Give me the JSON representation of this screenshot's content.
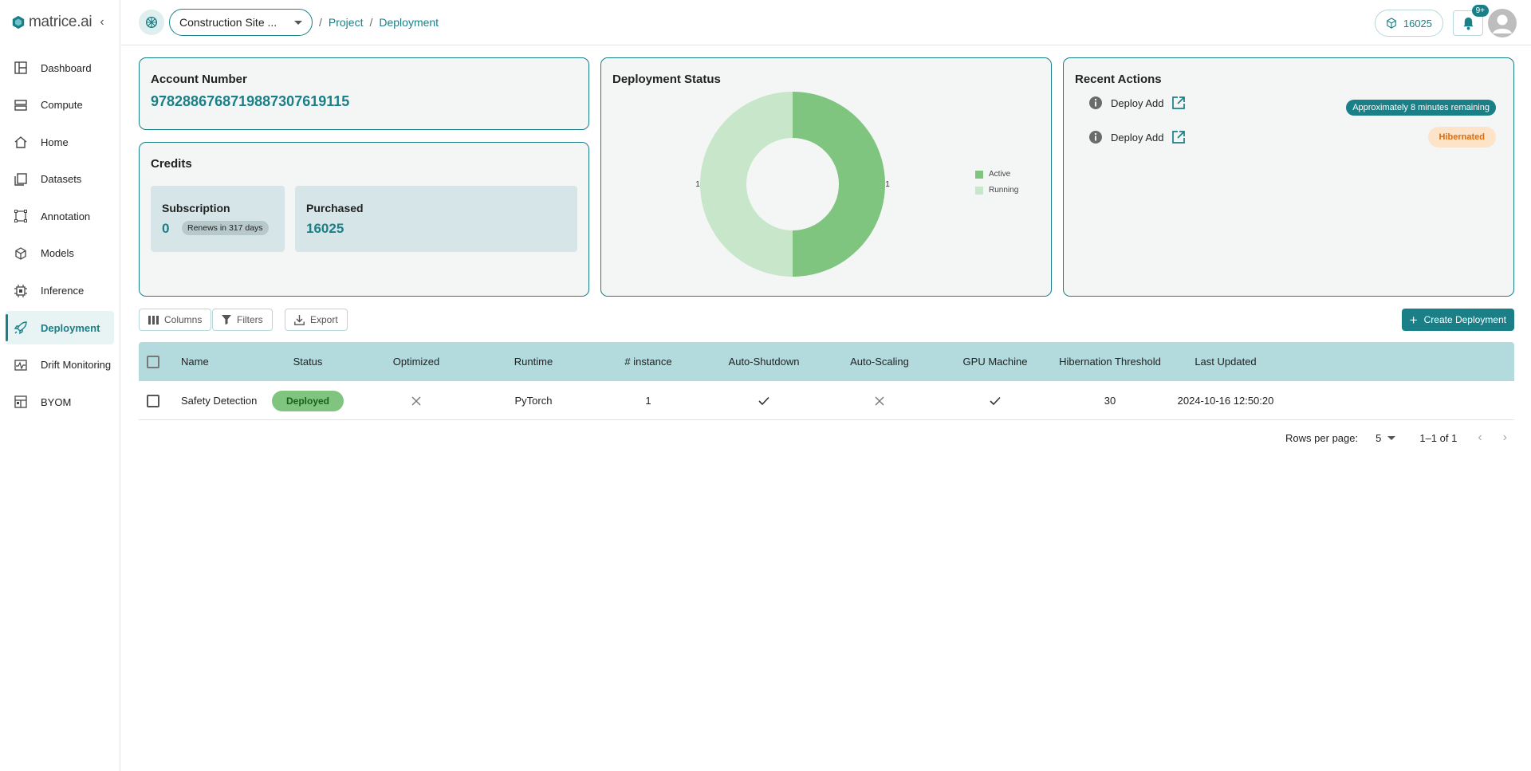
{
  "brand": {
    "name": "matrice.ai"
  },
  "sidebar": {
    "items": [
      {
        "label": "Dashboard",
        "icon": "dashboard-icon"
      },
      {
        "label": "Compute",
        "icon": "compute-icon"
      },
      {
        "label": "Home",
        "icon": "home-icon"
      },
      {
        "label": "Datasets",
        "icon": "datasets-icon"
      },
      {
        "label": "Annotation",
        "icon": "annotation-icon"
      },
      {
        "label": "Models",
        "icon": "models-icon"
      },
      {
        "label": "Inference",
        "icon": "inference-icon"
      },
      {
        "label": "Deployment",
        "icon": "rocket-icon",
        "active": true
      },
      {
        "label": "Drift Monitoring",
        "icon": "drift-icon"
      },
      {
        "label": "BYOM",
        "icon": "byom-icon"
      }
    ]
  },
  "header": {
    "project_name": "Construction Site ...",
    "breadcrumb": [
      "Project",
      "Deployment"
    ],
    "credits": "16025",
    "notifications_badge": "9+"
  },
  "account": {
    "title": "Account Number",
    "number": "97828867687198873076191​15"
  },
  "credits": {
    "title": "Credits",
    "subscription_label": "Subscription",
    "subscription_value": "0",
    "renews_text": "Renews in 317 days",
    "purchased_label": "Purchased",
    "purchased_value": "16025"
  },
  "deployment_status": {
    "title": "Deployment Status",
    "colors": {
      "Active": "#7fc57f",
      "Running": "#c8e6c9"
    }
  },
  "chart_data": {
    "type": "pie",
    "title": "Deployment Status",
    "categories": [
      "Active",
      "Running"
    ],
    "values": [
      1,
      1
    ],
    "legend": "right"
  },
  "recent_actions": {
    "title": "Recent Actions",
    "items": [
      {
        "label": "Deploy Add",
        "status": "Approximately 8 minutes remaining",
        "status_color": "#1a7f86"
      },
      {
        "label": "Deploy Add",
        "status": "Hibernated",
        "status_color": "#fde4c8"
      }
    ]
  },
  "toolbar": {
    "columns_label": "Columns",
    "filters_label": "Filters",
    "export_label": "Export",
    "create_label": "Create Deployment"
  },
  "table": {
    "headers": [
      "Name",
      "Status",
      "Optimized",
      "Runtime",
      "# instance",
      "Auto-Shutdown",
      "Auto-Scaling",
      "GPU Machine",
      "Hibernation Threshold",
      "Last Updated"
    ],
    "rows": [
      {
        "name": "Safety Detection",
        "status": "Deployed",
        "optimized": false,
        "runtime": "PyTorch",
        "instances": "1",
        "auto_shutdown": true,
        "auto_scaling": false,
        "gpu_machine": true,
        "hibernation_threshold": "30",
        "last_updated": "2024-10-16 12:50:20"
      }
    ]
  },
  "pagination": {
    "rows_per_page_label": "Rows per page:",
    "rows_per_page": "5",
    "range": "1–1 of 1"
  }
}
